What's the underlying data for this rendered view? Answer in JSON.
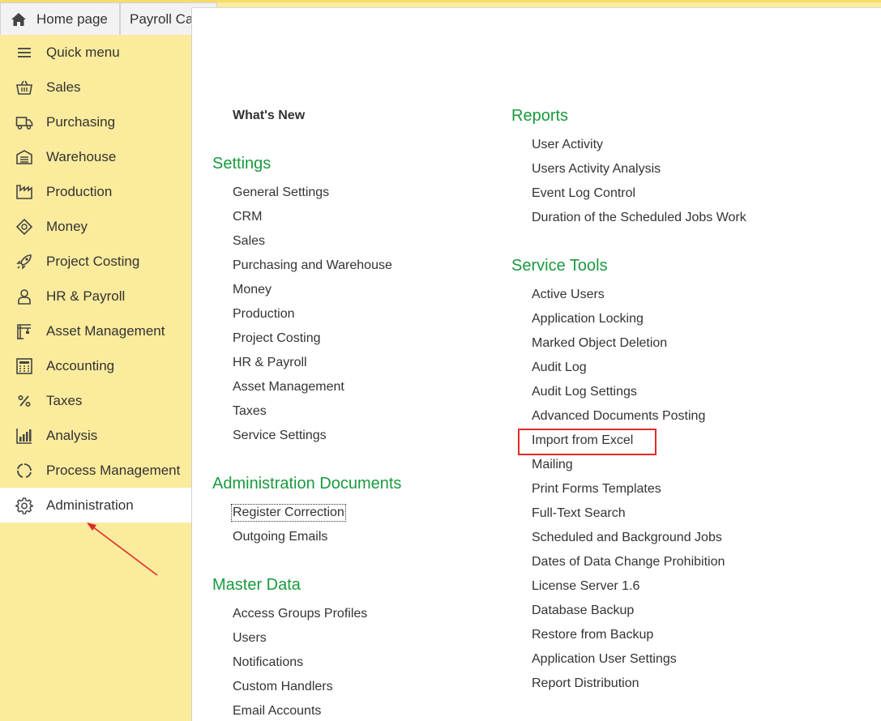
{
  "tabs": {
    "home": {
      "label": "Home page",
      "icon": "home-icon"
    },
    "payroll": {
      "label": "Payroll Ca"
    }
  },
  "sidebar": {
    "items": [
      {
        "label": "Quick menu",
        "icon": "menu-icon",
        "active": false
      },
      {
        "label": "Sales",
        "icon": "basket-icon",
        "active": false
      },
      {
        "label": "Purchasing",
        "icon": "truck-icon",
        "active": false
      },
      {
        "label": "Warehouse",
        "icon": "warehouse-icon",
        "active": false
      },
      {
        "label": "Production",
        "icon": "factory-icon",
        "active": false
      },
      {
        "label": "Money",
        "icon": "money-icon",
        "active": false
      },
      {
        "label": "Project Costing",
        "icon": "rocket-icon",
        "active": false
      },
      {
        "label": "HR & Payroll",
        "icon": "person-icon",
        "active": false
      },
      {
        "label": "Asset Management",
        "icon": "crane-icon",
        "active": false
      },
      {
        "label": "Accounting",
        "icon": "calculator-icon",
        "active": false
      },
      {
        "label": "Taxes",
        "icon": "percent-icon",
        "active": false
      },
      {
        "label": "Analysis",
        "icon": "bar-chart-icon",
        "active": false
      },
      {
        "label": "Process Management",
        "icon": "cycle-icon",
        "active": false
      },
      {
        "label": "Administration",
        "icon": "gear-icon",
        "active": true
      }
    ]
  },
  "main": {
    "whats_new": "What's New",
    "settings": {
      "title": "Settings",
      "items": [
        "General Settings",
        "CRM",
        "Sales",
        "Purchasing and Warehouse",
        "Money",
        "Production",
        "Project Costing",
        "HR & Payroll",
        "Asset Management",
        "Taxes",
        "Service Settings"
      ]
    },
    "admin_docs": {
      "title": "Administration Documents",
      "items": [
        "Register Correction",
        "Outgoing Emails"
      ]
    },
    "master_data": {
      "title": "Master Data",
      "items": [
        "Access Groups Profiles",
        "Users",
        "Notifications",
        "Custom Handlers",
        "Email Accounts"
      ]
    },
    "reports": {
      "title": "Reports",
      "items": [
        "User Activity",
        "Users Activity Analysis",
        "Event Log Control",
        "Duration of the Scheduled Jobs Work"
      ]
    },
    "service_tools": {
      "title": "Service Tools",
      "items": [
        "Active Users",
        "Application Locking",
        "Marked Object Deletion",
        "Audit Log",
        "Audit Log Settings",
        "Advanced Documents Posting",
        "Import from Excel",
        "Mailing",
        "Print Forms Templates",
        "Full-Text Search",
        "Scheduled and Background Jobs",
        "Dates of Data Change Prohibition",
        "License Server 1.6",
        "Database Backup",
        "Restore from Backup",
        "Application User Settings",
        "Report Distribution"
      ]
    }
  },
  "colors": {
    "sidebar_bg": "#fbeb9c",
    "section_title": "#1a9a3e",
    "annotation": "#e02a2a"
  }
}
